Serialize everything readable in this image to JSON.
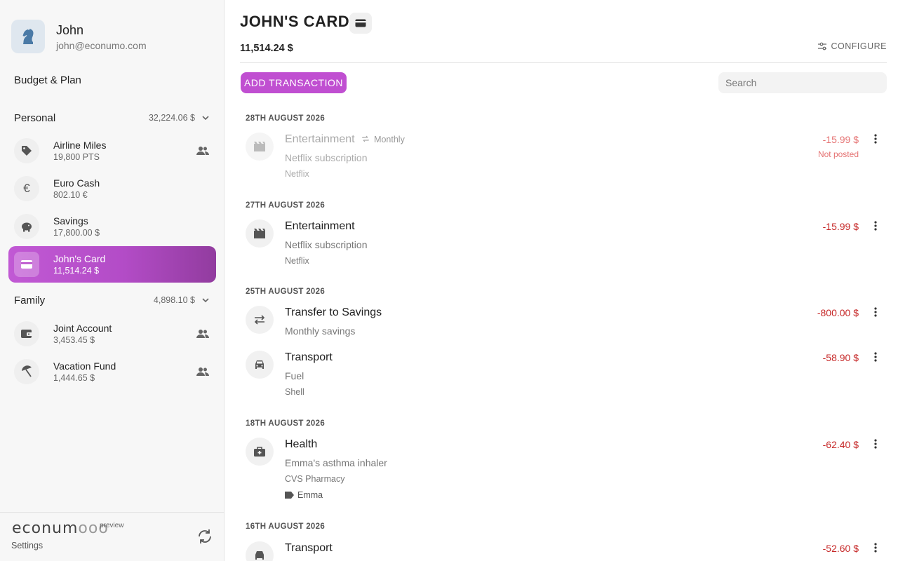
{
  "user": {
    "name": "John",
    "email": "john@econumo.com"
  },
  "nav": {
    "budget_label": "Budget & Plan"
  },
  "groups": [
    {
      "title": "Personal",
      "total": "32,224.06 $",
      "accounts": [
        {
          "name": "Airline Miles",
          "balance": "19,800 PTS",
          "icon": "tag-icon",
          "shared": true
        },
        {
          "name": "Euro Cash",
          "balance": "802.10 €",
          "icon": "euro-icon",
          "shared": false
        },
        {
          "name": "Savings",
          "balance": "17,800.00 $",
          "icon": "piggy-bank-icon",
          "shared": false
        },
        {
          "name": "John's Card",
          "balance": "11,514.24 $",
          "icon": "credit-card-icon",
          "shared": false,
          "active": true
        }
      ]
    },
    {
      "title": "Family",
      "total": "4,898.10 $",
      "accounts": [
        {
          "name": "Joint Account",
          "balance": "3,453.45 $",
          "icon": "wallet-icon",
          "shared": true
        },
        {
          "name": "Vacation Fund",
          "balance": "1,444.65 $",
          "icon": "beach-umbrella-icon",
          "shared": true
        }
      ]
    }
  ],
  "footer": {
    "logo": "econum",
    "logo_suffix": "ooo",
    "preview": "preview",
    "settings_label": "Settings"
  },
  "header": {
    "title": "JOHN'S CARD",
    "balance": "11,514.24 $",
    "configure_label": "CONFIGURE",
    "add_transaction_label": "ADD TRANSACTION",
    "search_placeholder": "Search"
  },
  "days": [
    {
      "date": "28TH AUGUST 2026",
      "transactions": [
        {
          "category": "Entertainment",
          "recurring": "Monthly",
          "description": "Netflix subscription",
          "payee": "Netflix",
          "amount": "-15.99 $",
          "status": "Not posted",
          "icon": "movie-icon"
        }
      ]
    },
    {
      "date": "27TH AUGUST 2026",
      "transactions": [
        {
          "category": "Entertainment",
          "description": "Netflix subscription",
          "payee": "Netflix",
          "amount": "-15.99 $",
          "icon": "movie-icon"
        }
      ]
    },
    {
      "date": "25TH AUGUST 2026",
      "transactions": [
        {
          "category": "Transfer to Savings",
          "description": "Monthly savings",
          "amount": "-800.00 $",
          "icon": "transfer-icon"
        },
        {
          "category": "Transport",
          "description": "Fuel",
          "payee": "Shell",
          "amount": "-58.90 $",
          "icon": "car-icon"
        }
      ]
    },
    {
      "date": "18TH AUGUST 2026",
      "transactions": [
        {
          "category": "Health",
          "description": "Emma's asthma inhaler",
          "payee": "CVS Pharmacy",
          "tag": "Emma",
          "amount": "-62.40 $",
          "icon": "medical-bag-icon"
        }
      ]
    },
    {
      "date": "16TH AUGUST 2026",
      "transactions": [
        {
          "category": "Transport",
          "amount": "-52.60 $",
          "icon": "car-icon"
        }
      ]
    }
  ],
  "colors": {
    "accent": "#c04fd1",
    "negative": "#c62828",
    "pending": "#e57373"
  }
}
